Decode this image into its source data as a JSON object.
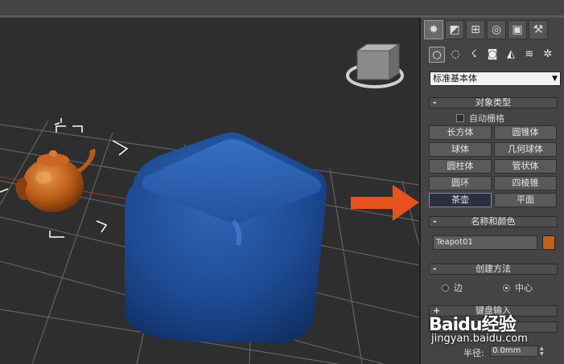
{
  "panel": {
    "tabs": [
      {
        "icon": "create-icon",
        "glyph": "✸"
      },
      {
        "icon": "modify-icon",
        "glyph": "◩"
      },
      {
        "icon": "hierarchy-icon",
        "glyph": "⊞"
      },
      {
        "icon": "motion-icon",
        "glyph": "◎"
      },
      {
        "icon": "display-icon",
        "glyph": "▣"
      },
      {
        "icon": "utilities-icon",
        "glyph": "⚒"
      }
    ],
    "subtabs": [
      {
        "icon": "geometry-icon",
        "glyph": "○"
      },
      {
        "icon": "shapes-icon",
        "glyph": "◌"
      },
      {
        "icon": "lights-icon",
        "glyph": "☇"
      },
      {
        "icon": "cameras-icon",
        "glyph": "◙"
      },
      {
        "icon": "helpers-icon",
        "glyph": "◭"
      },
      {
        "icon": "spacewarps-icon",
        "glyph": "≋"
      },
      {
        "icon": "systems-icon",
        "glyph": "✲"
      }
    ],
    "category_dropdown": "标准基本体",
    "object_type": {
      "title": "对象类型",
      "autogrid_label": "自动栅格",
      "buttons": [
        "长方体",
        "圆锥体",
        "球体",
        "几何球体",
        "圆柱体",
        "管状体",
        "圆环",
        "四棱锥",
        "茶壶",
        "平面"
      ],
      "pressed": "茶壶"
    },
    "name_color": {
      "title": "名称和颜色",
      "name_value": "Teapot01",
      "color": "#c4611b"
    },
    "creation_method": {
      "title": "创建方法",
      "options": [
        "边",
        "中心"
      ],
      "selected": "中心"
    },
    "keyboard_entry": {
      "title": "键盘输入"
    },
    "parameters": {
      "radius_label": "半径:",
      "radius_value": "0.0mm"
    }
  },
  "watermark": {
    "brand": "Baidu经验",
    "url": "jingyan.baidu.com"
  },
  "colors": {
    "viewport_bg": "#2e2e2e",
    "box_blue": "#1f4f98",
    "teapot_orange": "#c4611b",
    "arrow_red": "#e8521c",
    "grid": "#6a6a6a"
  }
}
